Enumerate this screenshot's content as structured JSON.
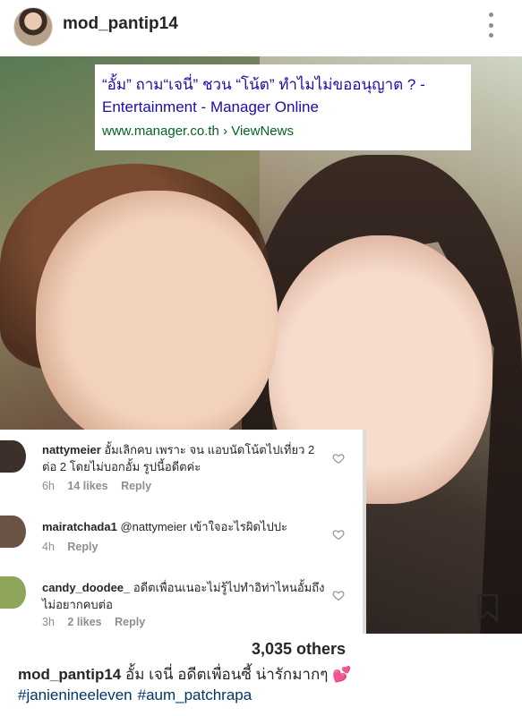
{
  "header": {
    "username": "mod_pantip14",
    "more_icon": "more-vertical-icon"
  },
  "link_card": {
    "title": "“อั้ม” ถาม“เจนี่” ชวน “โน้ต” ทำไมไม่ขออนุญาต ? - Entertainment - Manager Online",
    "url": "www.manager.co.th › ViewNews"
  },
  "comments": [
    {
      "username": "nattymeier",
      "text": "อั้มเลิกคบ เพราะ จน แอบนัดโน้ตไปเที่ยว 2 ต่อ 2 โดยไม่บอกอั้ม รูปนี้อดีตค่ะ",
      "time": "6h",
      "likes": "14 likes",
      "reply": "Reply",
      "avatar_color": "#3b302a"
    },
    {
      "username": "mairatchada1",
      "text": "@nattymeier เข้าใจอะไรผิดไปปะ",
      "time": "4h",
      "reply": "Reply",
      "avatar_color": "#6a5245"
    },
    {
      "username": "candy_doodee_",
      "text": "อดีตเพื่อนเนอะไม่รู้ไปทำอิท่าไหนอั้มถึงไม่อยากคบต่อ",
      "time": "3h",
      "likes": "2 likes",
      "reply": "Reply",
      "avatar_color": "#8fa55a"
    }
  ],
  "actions": {
    "bookmark_icon": "bookmark-icon"
  },
  "likes_text": "3,035 others",
  "caption": {
    "username": "mod_pantip14",
    "text": "อั้ม เจนี่ อดีตเพื่อนซี้ น่ารักมากๆ 💕",
    "hashtags": [
      "#janienineeleven",
      "#aum_patchrapa"
    ]
  }
}
